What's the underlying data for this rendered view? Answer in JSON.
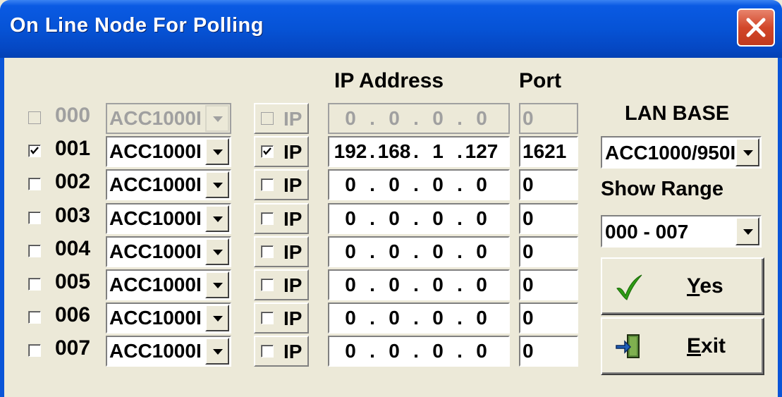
{
  "window": {
    "title": "On Line Node For Polling"
  },
  "headers": {
    "ip_address": "IP Address",
    "port": "Port"
  },
  "rows": [
    {
      "node": "000",
      "checked": false,
      "enabled": false,
      "base": "ACC1000I",
      "ip_label": "IP",
      "ip_checked": false,
      "ip": [
        "0",
        "0",
        "0",
        "0"
      ],
      "port": "0"
    },
    {
      "node": "001",
      "checked": true,
      "enabled": true,
      "base": "ACC1000I",
      "ip_label": "IP",
      "ip_checked": true,
      "ip": [
        "192",
        "168",
        "1",
        "127"
      ],
      "port": "1621"
    },
    {
      "node": "002",
      "checked": false,
      "enabled": true,
      "base": "ACC1000I",
      "ip_label": "IP",
      "ip_checked": false,
      "ip": [
        "0",
        "0",
        "0",
        "0"
      ],
      "port": "0"
    },
    {
      "node": "003",
      "checked": false,
      "enabled": true,
      "base": "ACC1000I",
      "ip_label": "IP",
      "ip_checked": false,
      "ip": [
        "0",
        "0",
        "0",
        "0"
      ],
      "port": "0"
    },
    {
      "node": "004",
      "checked": false,
      "enabled": true,
      "base": "ACC1000I",
      "ip_label": "IP",
      "ip_checked": false,
      "ip": [
        "0",
        "0",
        "0",
        "0"
      ],
      "port": "0"
    },
    {
      "node": "005",
      "checked": false,
      "enabled": true,
      "base": "ACC1000I",
      "ip_label": "IP",
      "ip_checked": false,
      "ip": [
        "0",
        "0",
        "0",
        "0"
      ],
      "port": "0"
    },
    {
      "node": "006",
      "checked": false,
      "enabled": true,
      "base": "ACC1000I",
      "ip_label": "IP",
      "ip_checked": false,
      "ip": [
        "0",
        "0",
        "0",
        "0"
      ],
      "port": "0"
    },
    {
      "node": "007",
      "checked": false,
      "enabled": true,
      "base": "ACC1000I",
      "ip_label": "IP",
      "ip_checked": false,
      "ip": [
        "0",
        "0",
        "0",
        "0"
      ],
      "port": "0"
    }
  ],
  "lan_base": {
    "label": "LAN BASE",
    "value": "ACC1000/950I"
  },
  "show_range": {
    "label": "Show Range",
    "value": "000 - 007"
  },
  "buttons": {
    "yes_mnemonic": "Y",
    "yes_rest": "es",
    "exit_mnemonic": "E",
    "exit_rest": "xit"
  },
  "colors": {
    "titlebar": "#0653d6",
    "dialog_bg": "#ece9d8",
    "close_button": "#d2472a",
    "yes_check": "#2e9c14"
  },
  "icons": {
    "close": "close-icon",
    "yes": "checkmark-icon",
    "exit": "exit-door-icon"
  }
}
